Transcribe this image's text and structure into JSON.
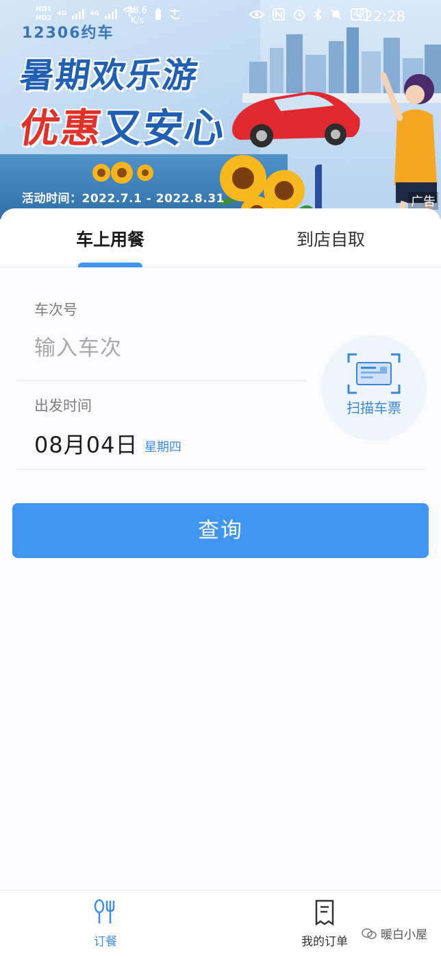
{
  "status_bar": {
    "sim1": "HD1",
    "sim2": "HD2",
    "network": "4G",
    "speed_value": "38.6",
    "speed_unit": "K/s",
    "battery": "49",
    "time": "22:28"
  },
  "banner": {
    "brand": "12306约车",
    "headline_line1": "暑期欢乐游",
    "headline_red": "优惠",
    "headline_blue": "又安心",
    "period": "活动时间：2022.7.1 - 2022.8.31",
    "ad_label": "广告"
  },
  "tabs": {
    "onboard": "车上用餐",
    "pickup": "到店自取"
  },
  "form": {
    "train_label": "车次号",
    "train_placeholder": "输入车次",
    "date_label": "出发时间",
    "date_value": "08月04日",
    "weekday": "星期四",
    "scan_label": "扫描车票",
    "query_button": "查询"
  },
  "bottom_nav": {
    "order": "订餐",
    "my_orders": "我的订单",
    "watermark": "暖白小屋"
  },
  "colors": {
    "accent": "#3f95f0",
    "accent_text": "#3f8fe8",
    "placeholder": "#a9a9a9"
  }
}
